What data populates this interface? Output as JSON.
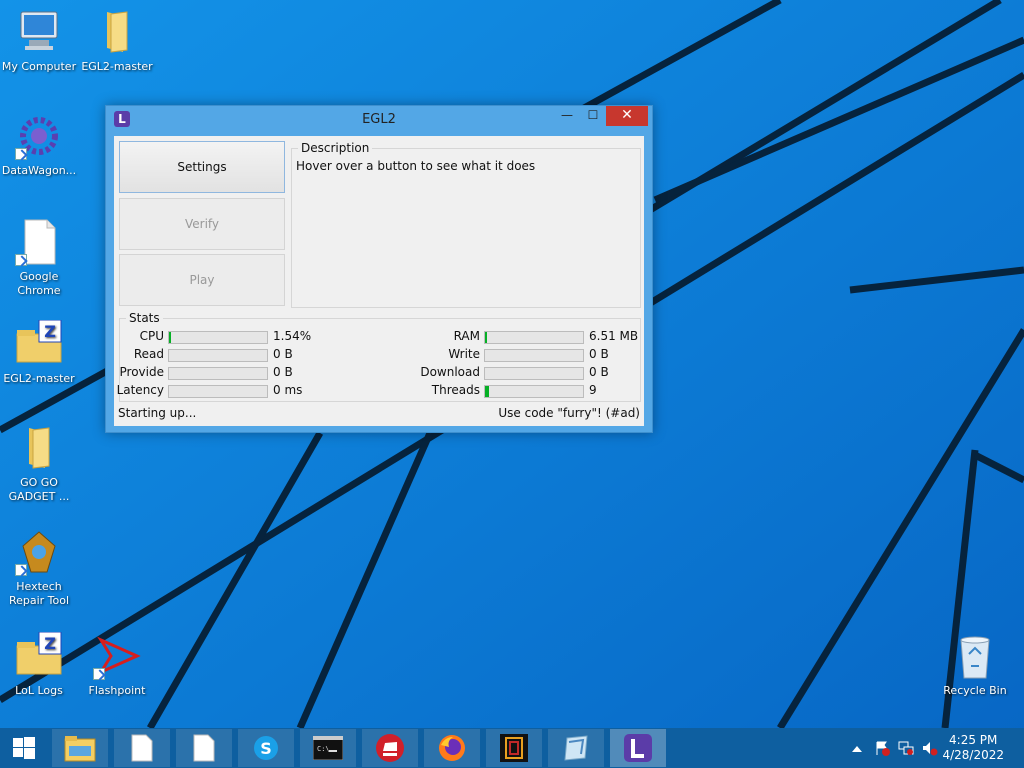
{
  "desktop": {
    "icons": [
      {
        "label": "My Computer"
      },
      {
        "label": "EGL2-master"
      },
      {
        "label": "DataWagon..."
      },
      {
        "label": "Google Chrome"
      },
      {
        "label": "EGL2-master"
      },
      {
        "label": "GO GO GADGET ..."
      },
      {
        "label": "Hextech Repair Tool"
      },
      {
        "label": "LoL Logs"
      },
      {
        "label": "Flashpoint"
      },
      {
        "label": "Recycle Bin"
      }
    ]
  },
  "window": {
    "title": "EGL2",
    "close_glyph": "✕",
    "minimize_glyph": "—",
    "maximize_glyph": "☐",
    "buttons": {
      "settings": "Settings",
      "verify": "Verify",
      "play": "Play"
    },
    "description": {
      "legend": "Description",
      "text": "Hover over a button to see what it does"
    },
    "stats": {
      "legend": "Stats",
      "left": [
        {
          "label": "CPU",
          "value": "1.54%",
          "fill": 0.0154
        },
        {
          "label": "Read",
          "value": "0 B",
          "fill": 0
        },
        {
          "label": "Provide",
          "value": "0 B",
          "fill": 0
        },
        {
          "label": "Latency",
          "value": "0 ms",
          "fill": 0
        }
      ],
      "right": [
        {
          "label": "RAM",
          "value": "6.51 MB",
          "fill": 0.01
        },
        {
          "label": "Write",
          "value": "0 B",
          "fill": 0
        },
        {
          "label": "Download",
          "value": "0 B",
          "fill": 0
        },
        {
          "label": "Threads",
          "value": "9",
          "fill": 0.04
        }
      ]
    },
    "status_left": "Starting up...",
    "status_right": "Use code \"furry\"! (#ad)"
  },
  "taskbar": {
    "items": [
      "file-explorer-icon",
      "document-icon",
      "document-icon",
      "skype-icon",
      "command-prompt-icon",
      "riot-client-icon",
      "firefox-icon",
      "app-icon",
      "app-icon",
      "egl2-icon"
    ],
    "clock_time": "4:25 PM",
    "clock_date": "4/28/2022"
  },
  "colors": {
    "wallpaper": "#0a78d7",
    "window_border": "#53a7e6",
    "close_red": "#c7372e",
    "progress_green": "#06b025",
    "taskbar": "#0e5fa0"
  }
}
